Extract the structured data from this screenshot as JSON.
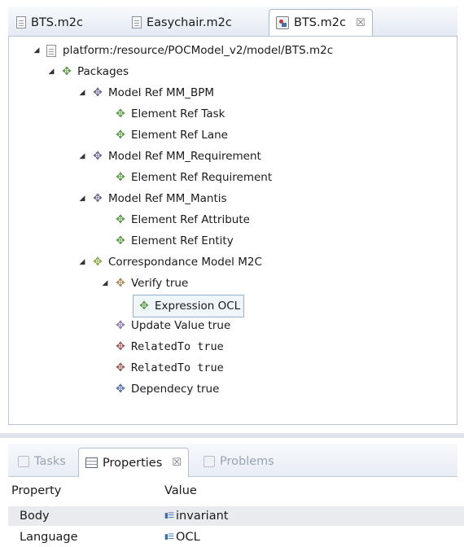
{
  "editor_tabs": [
    {
      "label": "BTS.m2c",
      "icon": "document-icon",
      "active": false
    },
    {
      "label": "Easychair.m2c",
      "icon": "document-icon",
      "active": false
    },
    {
      "label": "BTS.m2c",
      "icon": "m2c-model-icon",
      "active": true,
      "close": "☒"
    }
  ],
  "tree": [
    {
      "label": "platform:/resource/POCModel_v2/model/BTS.m2c",
      "icon": "file-icon"
    },
    {
      "label": "Packages",
      "icon": "package-icon",
      "color": "#5f9a4a"
    },
    {
      "label": "Model Ref MM_BPM",
      "icon": "model-ref-icon",
      "color": "#6e6b8f"
    },
    {
      "label": "Element Ref Task",
      "icon": "element-ref-icon",
      "color": "#5f9a4a"
    },
    {
      "label": "Element Ref Lane",
      "icon": "element-ref-icon",
      "color": "#5f9a4a"
    },
    {
      "label": "Model Ref MM_Requirement",
      "icon": "model-ref-icon",
      "color": "#6e6b8f"
    },
    {
      "label": "Element Ref Requirement",
      "icon": "element-ref-icon",
      "color": "#5f9a4a"
    },
    {
      "label": "Model Ref MM_Mantis",
      "icon": "model-ref-icon",
      "color": "#6e6b8f"
    },
    {
      "label": "Element Ref Attribute",
      "icon": "element-ref-icon",
      "color": "#5f9a4a"
    },
    {
      "label": "Element Ref Entity",
      "icon": "element-ref-icon",
      "color": "#5f9a4a"
    },
    {
      "label": "Correspondance Model M2C",
      "icon": "correspondence-icon",
      "color": "#8aa84a"
    },
    {
      "label": "Verify true",
      "icon": "verify-icon",
      "color": "#a88a5a"
    },
    {
      "label": "Expression OCL",
      "icon": "expression-icon",
      "color": "#5f9a4a"
    },
    {
      "label": "Update Value true",
      "icon": "update-value-icon",
      "color": "#8a7aa8"
    },
    {
      "label": "RelatedTo true",
      "icon": "related-to-icon",
      "color": "#9a5a5a"
    },
    {
      "label": "RelatedTo true",
      "icon": "related-to-icon",
      "color": "#9a5a5a"
    },
    {
      "label": "Dependecy true",
      "icon": "dependency-icon",
      "color": "#5a6fa8"
    }
  ],
  "bottom_tabs": [
    {
      "label": "Tasks",
      "active": false
    },
    {
      "label": "Properties",
      "active": true,
      "close": "☒"
    },
    {
      "label": "Problems",
      "active": false
    }
  ],
  "properties": {
    "header": {
      "property": "Property",
      "value": "Value"
    },
    "rows": [
      {
        "property": "Body",
        "value": "invariant"
      },
      {
        "property": "Language",
        "value": "OCL"
      }
    ]
  },
  "glyphs": {
    "expanded": "◢",
    "node": "✥"
  }
}
